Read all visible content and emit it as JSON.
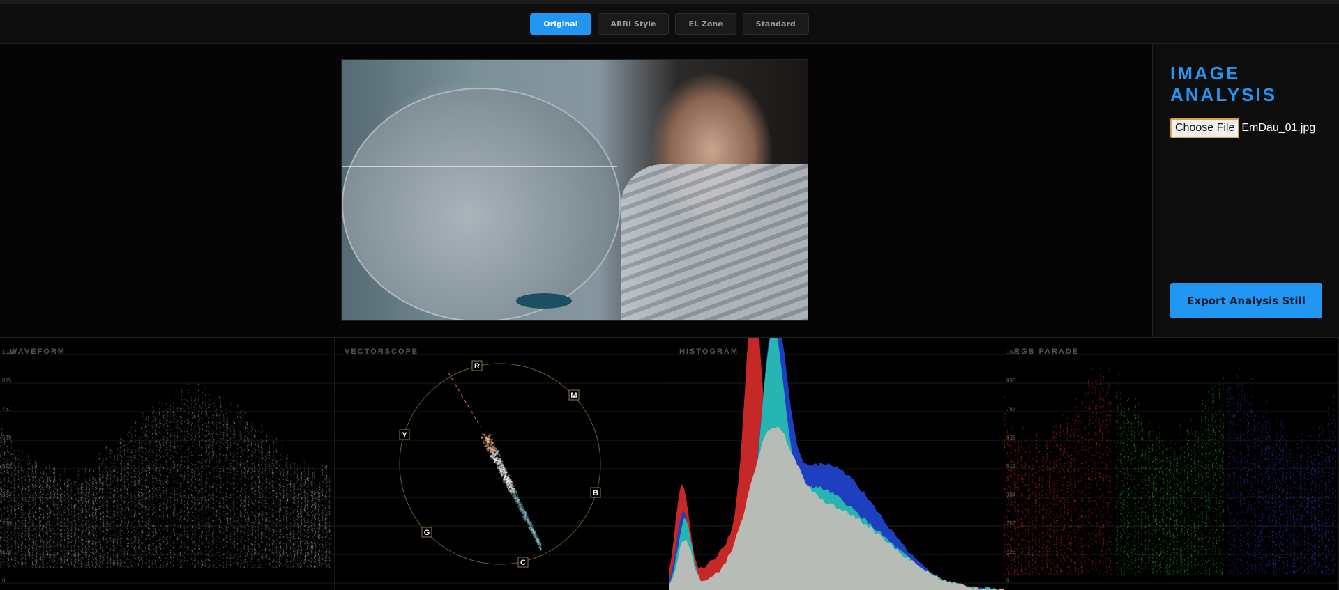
{
  "modes": [
    {
      "label": "Original",
      "active": true
    },
    {
      "label": "ARRI Style",
      "active": false
    },
    {
      "label": "EL Zone",
      "active": false
    },
    {
      "label": "Standard",
      "active": false
    }
  ],
  "sidebar": {
    "title_line1": "IMAGE",
    "title_line2": "ANALYSIS",
    "choose_file": "Choose File",
    "file_name": "EmDau_01.jpg",
    "export_label": "Export Analysis Still"
  },
  "colors": {
    "accent": "#2196f3"
  },
  "scopes": {
    "waveform": {
      "label": "WAVEFORM",
      "ticks": [
        "1023",
        "895",
        "767",
        "639",
        "512",
        "384",
        "256",
        "128",
        "0"
      ]
    },
    "vectorscope": {
      "label": "VECTORSCOPE",
      "targets": [
        "R",
        "M",
        "B",
        "C",
        "G",
        "Y"
      ]
    },
    "histogram": {
      "label": "HISTOGRAM"
    },
    "parade": {
      "label": "RGB PARADE",
      "ticks": [
        "1023",
        "895",
        "767",
        "639",
        "512",
        "384",
        "256",
        "128",
        "0"
      ]
    }
  }
}
